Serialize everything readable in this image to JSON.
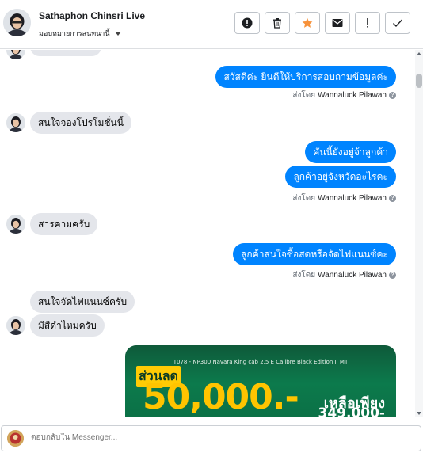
{
  "header": {
    "contact_name": "Sathaphon Chinsri Live",
    "assign_label": "มอบหมายการสนทนานี้",
    "actions": [
      {
        "name": "report-button",
        "icon": "exclamation-circle-icon"
      },
      {
        "name": "delete-button",
        "icon": "trash-icon"
      },
      {
        "name": "star-button",
        "icon": "star-icon"
      },
      {
        "name": "mark-unread-button",
        "icon": "envelope-icon"
      },
      {
        "name": "follow-up-button",
        "icon": "exclamation-icon"
      },
      {
        "name": "mark-done-button",
        "icon": "check-icon"
      }
    ]
  },
  "colors": {
    "outgoing_bubble": "#0084ff",
    "incoming_bubble": "#e4e6eb",
    "star": "#f7923a"
  },
  "messages": [
    {
      "id": "m1",
      "direction": "out",
      "text": "สวัสดีค่ะ  ยินดีให้บริการสอบถามข้อมูลค่ะ"
    },
    {
      "id": "m1s",
      "sent_by_prefix": "ส่งโดย",
      "sent_by_name": "Wannaluck Pilawan"
    },
    {
      "id": "m2",
      "direction": "in",
      "text": "สนใจจองโปรโมชั่นนี้"
    },
    {
      "id": "m3",
      "direction": "out",
      "text": "คันนี้ยังอยู่จ้าลูกค้า"
    },
    {
      "id": "m4",
      "direction": "out",
      "text": "ลูกค้าอยู่จังหวัดอะไรคะ"
    },
    {
      "id": "m4s",
      "sent_by_prefix": "ส่งโดย",
      "sent_by_name": "Wannaluck Pilawan"
    },
    {
      "id": "m5",
      "direction": "in",
      "text": "สารคามครับ"
    },
    {
      "id": "m6",
      "direction": "out",
      "text": "ลูกค้าสนใจซื้อสดหรือจัดไฟแนนซ์คะ"
    },
    {
      "id": "m6s",
      "sent_by_prefix": "ส่งโดย",
      "sent_by_name": "Wannaluck Pilawan"
    },
    {
      "id": "m7",
      "direction": "in",
      "text": "สนใจจัดไฟแนนซ์ครับ"
    },
    {
      "id": "m8",
      "direction": "in",
      "text": "มีสีดำไหมครับ"
    }
  ],
  "promo_image": {
    "title": "T078 - NP300 Navara King cab 2.5 E Calibre Black Edition II MT",
    "badge": "ส่วนลด",
    "discount": "50,000.-",
    "remain_label": "เหลือเพียง",
    "price": "349,000-"
  },
  "composer": {
    "placeholder": "ตอบกลับใน Messenger..."
  }
}
